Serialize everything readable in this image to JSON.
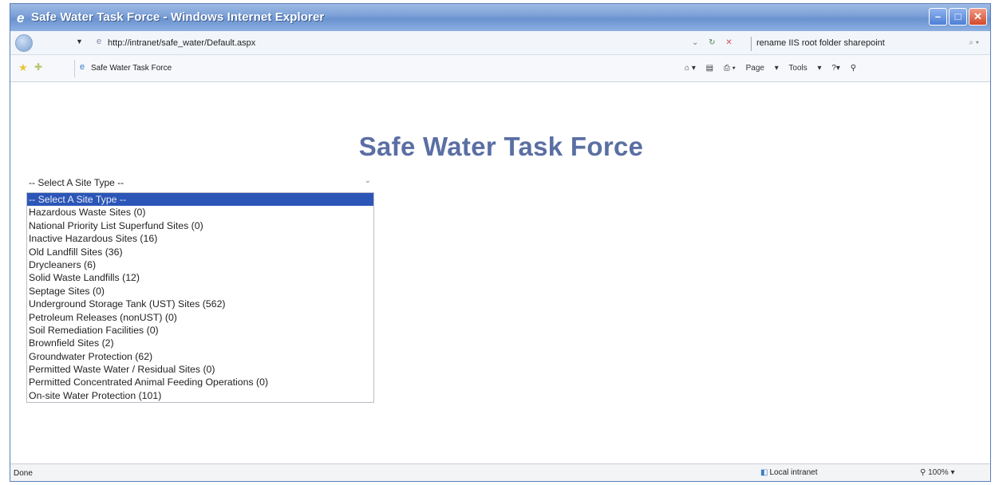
{
  "window": {
    "title": "Safe Water Task Force - Windows Internet Explorer",
    "controls": {
      "minimize": "–",
      "maximize": "□",
      "close": "✕"
    }
  },
  "address_bar": {
    "url": "http://intranet/safe_water/Default.aspx",
    "search_value": "rename IIS root folder sharepoint"
  },
  "favorites_bar": {
    "tab_label": "Safe Water Task Force",
    "commands": {
      "page": "Page",
      "tools": "Tools"
    }
  },
  "page": {
    "title": "Safe Water Task Force",
    "select": {
      "selected_value": "-- Select A Site Type --",
      "options": [
        "-- Select A Site Type --",
        "Hazardous Waste Sites (0)",
        "National Priority List Superfund Sites (0)",
        "Inactive Hazardous Sites (16)",
        "Old Landfill Sites (36)",
        "Drycleaners (6)",
        "Solid Waste Landfills (12)",
        "Septage Sites (0)",
        "Underground Storage Tank (UST) Sites (562)",
        "Petroleum Releases (nonUST) (0)",
        "Soil Remediation Facilities (0)",
        "Brownfield Sites (2)",
        "Groundwater Protection (62)",
        "Permitted Waste Water / Residual Sites (0)",
        "Permitted Concentrated Animal Feeding Operations (0)",
        "On-site Water Protection (101)"
      ],
      "highlighted_index": 0
    }
  },
  "status_bar": {
    "status": "Done",
    "zone": "Local intranet",
    "zoom": "100%"
  },
  "colors": {
    "title_blue": "#5a6fa3",
    "selection_blue": "#2b56b8",
    "titlebar_blue": "#7a9fd6"
  }
}
